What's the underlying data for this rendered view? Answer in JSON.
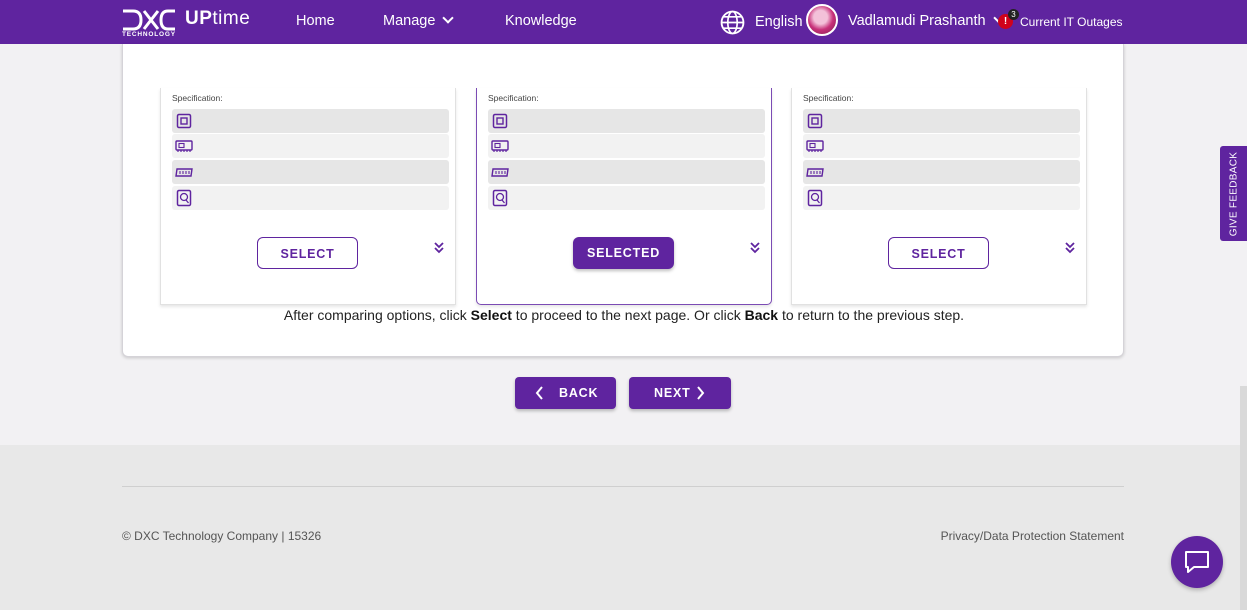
{
  "header": {
    "logo_text": "DXC",
    "logo_sub": "TECHNOLOGY",
    "brand_prefix": "UP",
    "brand_suffix": "time",
    "nav": [
      {
        "label": "Home"
      },
      {
        "label": "Manage"
      },
      {
        "label": "Knowledge"
      }
    ],
    "language": "English",
    "user_name": "Vadlamudi Prashanth",
    "alert_symbol": "!",
    "alert_count": "3",
    "outages_label": "Current IT Outages"
  },
  "cards": [
    {
      "spec_label": "Specification:",
      "button_label": "SELECT",
      "selected": false
    },
    {
      "spec_label": "Specification:",
      "button_label": "SELECTED",
      "selected": true
    },
    {
      "spec_label": "Specification:",
      "button_label": "SELECT",
      "selected": false
    }
  ],
  "spec_icons": [
    "cpu-icon",
    "memory-icon",
    "ram-icon",
    "disk-icon"
  ],
  "instructions": {
    "part1": "After comparing options, click ",
    "select_word": "Select",
    "part2": " to proceed to the next page. Or click ",
    "back_word": "Back",
    "part3": " to return to the previous step."
  },
  "navigation": {
    "back_label": "BACK",
    "next_label": "NEXT"
  },
  "footer": {
    "copyright": "© DXC Technology Company | 15326",
    "privacy": "Privacy/Data Protection Statement"
  },
  "feedback_label": "GIVE FEEDBACK",
  "colors": {
    "brand": "#5f249f",
    "alert": "#d0021b"
  }
}
